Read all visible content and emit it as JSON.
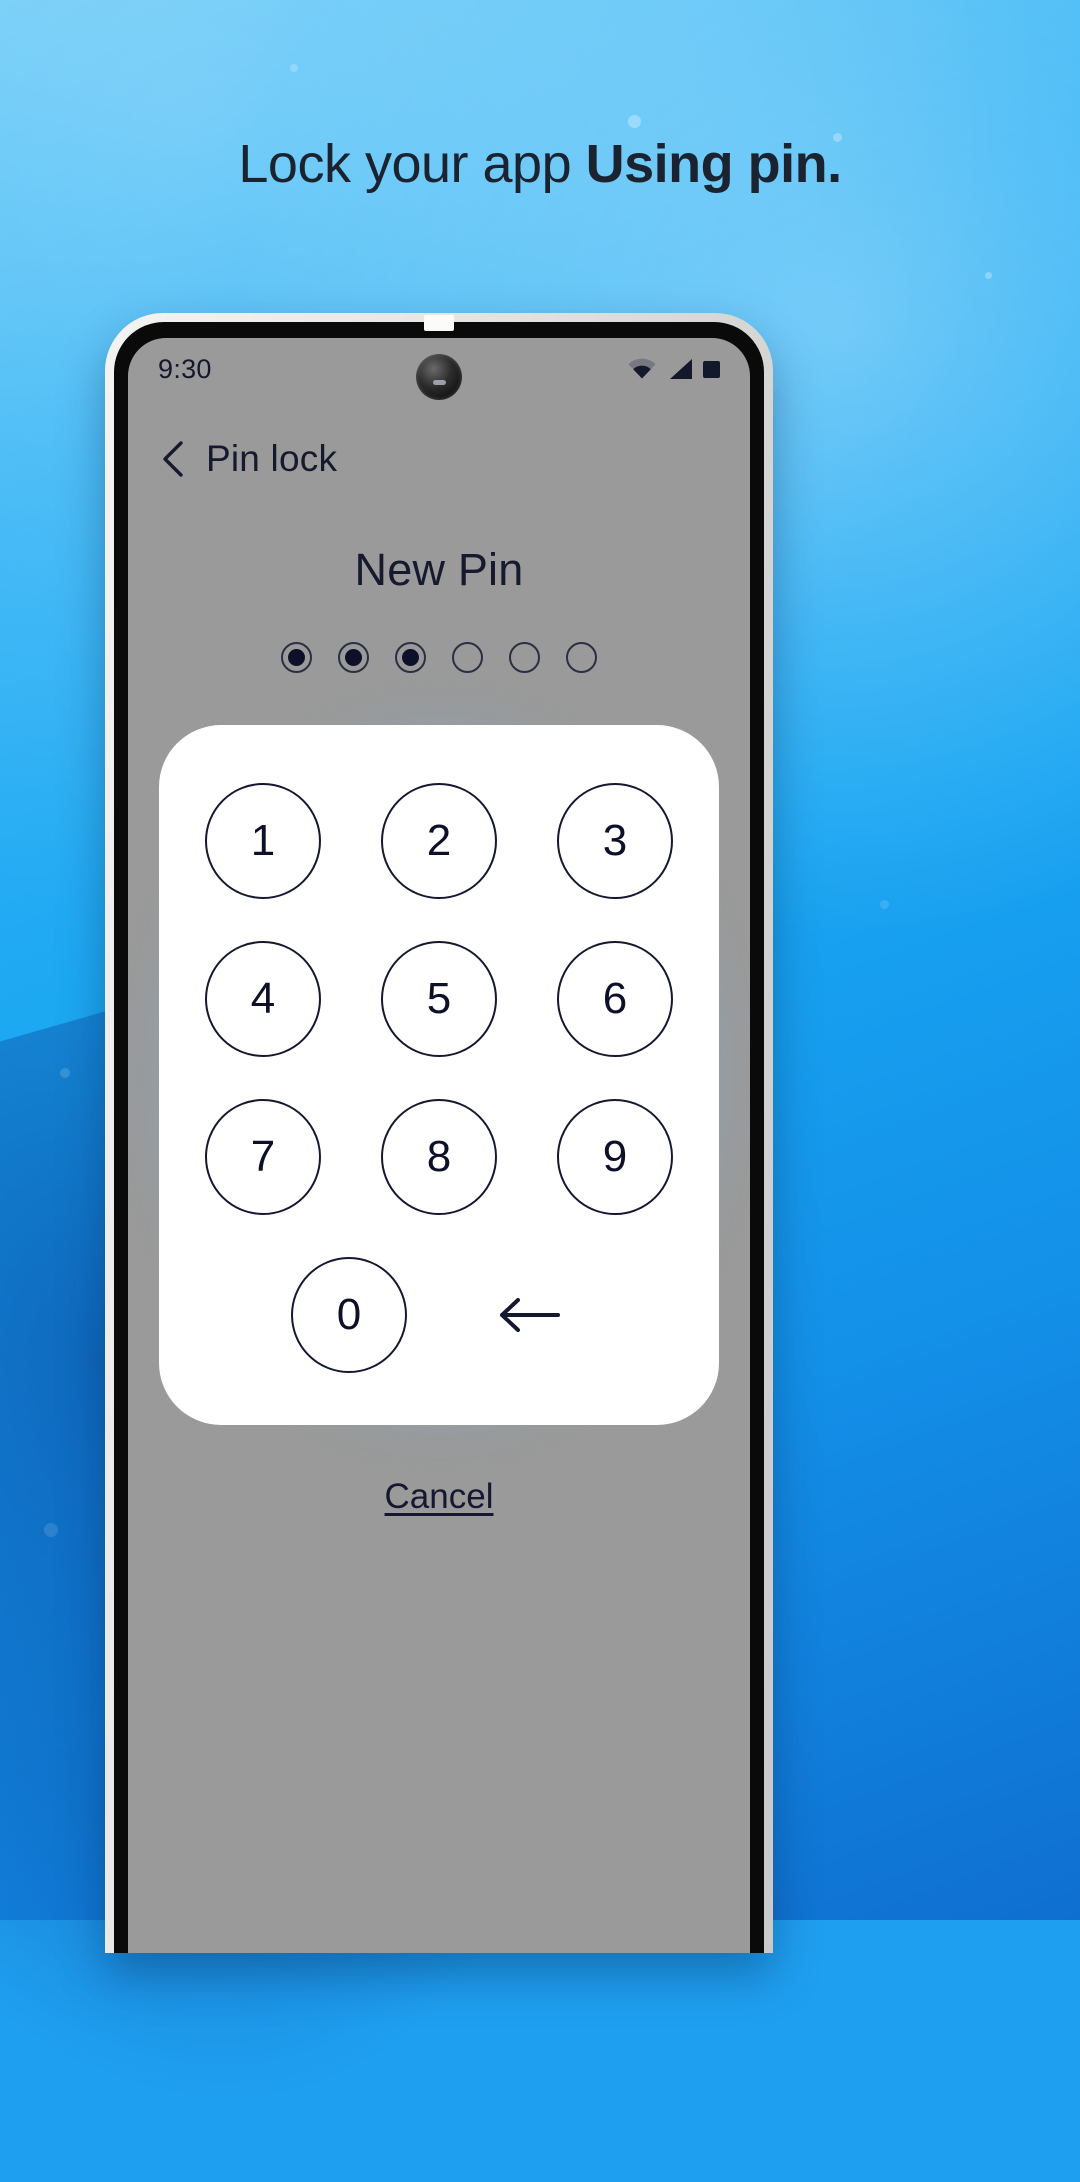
{
  "promo": {
    "headline_regular": "Lock your app ",
    "headline_bold": "Using pin.",
    "background_top_color": "#63c8f7",
    "background_bottom_color": "#0f6fd0"
  },
  "phone": {
    "statusbar": {
      "clock": "9:30",
      "wifi_icon": "wifi-icon",
      "signal_icon": "signal-icon",
      "battery_icon": "battery-icon",
      "camera_icon": "front-camera-punchhole"
    },
    "appbar": {
      "back_icon": "chevron-left-icon",
      "title": "Pin lock"
    },
    "screen": {
      "title": "New Pin",
      "screen_background": "#9a9a9a",
      "accent_glow": "#78cdff",
      "text_color": "#0d1028",
      "pin_dots": {
        "total": 6,
        "filled": 3,
        "states": [
          true,
          true,
          true,
          false,
          false,
          false
        ]
      },
      "keypad": {
        "rows": [
          [
            "1",
            "2",
            "3"
          ],
          [
            "4",
            "5",
            "6"
          ],
          [
            "7",
            "8",
            "9"
          ]
        ],
        "zero_label": "0",
        "backspace_icon": "backspace-arrow-icon"
      },
      "cancel_label": "Cancel"
    }
  }
}
